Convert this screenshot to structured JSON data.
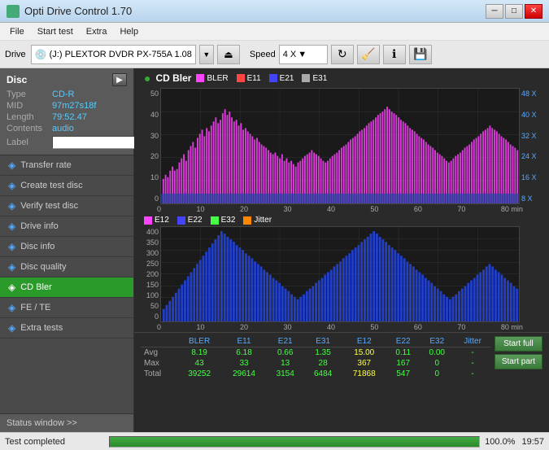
{
  "app": {
    "title": "Opti Drive Control 1.70",
    "icon": "◆"
  },
  "titlebar": {
    "buttons": {
      "minimize": "─",
      "maximize": "□",
      "close": "✕"
    }
  },
  "menu": {
    "items": [
      "File",
      "Start test",
      "Extra",
      "Help"
    ]
  },
  "toolbar": {
    "drive_label": "Drive",
    "drive_icon": "💿",
    "drive_value": "(J:)  PLEXTOR DVDR  PX-755A 1.08",
    "speed_label": "Speed",
    "speed_value": "4 X",
    "eject_icon": "⏏"
  },
  "disc": {
    "title": "Disc",
    "type_label": "Type",
    "type_value": "CD-R",
    "mid_label": "MID",
    "mid_value": "97m27s18f",
    "length_label": "Length",
    "length_value": "79:52.47",
    "contents_label": "Contents",
    "contents_value": "audio",
    "label_label": "Label",
    "label_value": "",
    "label_placeholder": ""
  },
  "sidebar": {
    "items": [
      {
        "id": "transfer-rate",
        "label": "Transfer rate",
        "icon": "◈"
      },
      {
        "id": "create-test-disc",
        "label": "Create test disc",
        "icon": "◈"
      },
      {
        "id": "verify-test-disc",
        "label": "Verify test disc",
        "icon": "◈"
      },
      {
        "id": "drive-info",
        "label": "Drive info",
        "icon": "◈"
      },
      {
        "id": "disc-info",
        "label": "Disc info",
        "icon": "◈"
      },
      {
        "id": "disc-quality",
        "label": "Disc quality",
        "icon": "◈"
      },
      {
        "id": "cd-bler",
        "label": "CD Bler",
        "icon": "◈",
        "active": true
      },
      {
        "id": "fe-te",
        "label": "FE / TE",
        "icon": "◈"
      },
      {
        "id": "extra-tests",
        "label": "Extra tests",
        "icon": "◈"
      }
    ],
    "status_window": "Status window >>"
  },
  "chart1": {
    "title": "CD Bler",
    "icon": "●",
    "legend": [
      {
        "id": "bler",
        "label": "BLER",
        "color": "#ff44ff"
      },
      {
        "id": "e11",
        "label": "E11",
        "color": "#ff4444"
      },
      {
        "id": "e21",
        "label": "E21",
        "color": "#4444ff"
      },
      {
        "id": "e31",
        "label": "E31",
        "color": "#888888"
      }
    ],
    "y_axis": [
      "50",
      "40",
      "30",
      "20",
      "10",
      "0"
    ],
    "y_right": [
      "48 X",
      "40 X",
      "32 X",
      "24 X",
      "16 X",
      "8 X"
    ],
    "x_axis": [
      "0",
      "10",
      "20",
      "30",
      "40",
      "50",
      "60",
      "70",
      "80 min"
    ]
  },
  "chart2": {
    "legend": [
      {
        "id": "e12",
        "label": "E12",
        "color": "#ff44ff"
      },
      {
        "id": "e22",
        "label": "E22",
        "color": "#4444ff"
      },
      {
        "id": "e32",
        "label": "E32",
        "color": "#44ff44"
      },
      {
        "id": "jitter",
        "label": "Jitter",
        "color": "#ff8800"
      }
    ],
    "y_axis": [
      "400",
      "350",
      "300",
      "250",
      "200",
      "150",
      "100",
      "50",
      "0"
    ],
    "x_axis": [
      "0",
      "10",
      "20",
      "30",
      "40",
      "50",
      "60",
      "70",
      "80 min"
    ]
  },
  "stats": {
    "columns": [
      "",
      "BLER",
      "E11",
      "E21",
      "E31",
      "E12",
      "E22",
      "E32",
      "Jitter",
      ""
    ],
    "rows": [
      {
        "label": "Avg",
        "bler": "8.19",
        "e11": "6.18",
        "e21": "0.66",
        "e31": "1.35",
        "e12": "15.00",
        "e22": "0.11",
        "e32": "0.00",
        "jitter": "-"
      },
      {
        "label": "Max",
        "bler": "43",
        "e11": "33",
        "e21": "13",
        "e31": "28",
        "e12": "367",
        "e22": "167",
        "e32": "0",
        "jitter": "-"
      },
      {
        "label": "Total",
        "bler": "39252",
        "e11": "29614",
        "e21": "3154",
        "e31": "6484",
        "e12": "71868",
        "e22": "547",
        "e32": "0",
        "jitter": "-"
      }
    ],
    "buttons": {
      "start_full": "Start full",
      "start_part": "Start part"
    }
  },
  "statusbar": {
    "text": "Test completed",
    "progress": 100,
    "progress_pct": "100.0%",
    "time": "19:57"
  }
}
